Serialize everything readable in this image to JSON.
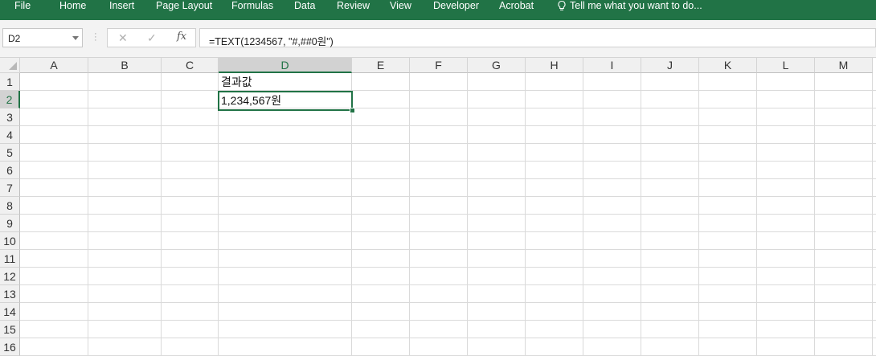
{
  "ribbon": {
    "tabs": [
      "File",
      "Home",
      "Insert",
      "Page Layout",
      "Formulas",
      "Data",
      "Review",
      "View",
      "Developer",
      "Acrobat"
    ],
    "tell_me": "Tell me what you want to do..."
  },
  "formula_bar": {
    "name_box": "D2",
    "cancel_glyph": "✕",
    "enter_glyph": "✓",
    "fx_label": "fx",
    "formula": "=TEXT(1234567, \"#,##0원\")"
  },
  "sheet": {
    "columns": [
      "A",
      "B",
      "C",
      "D",
      "E",
      "F",
      "G",
      "H",
      "I",
      "J",
      "K",
      "L",
      "M"
    ],
    "rows": [
      "1",
      "2",
      "3",
      "4",
      "5",
      "6",
      "7",
      "8",
      "9",
      "10",
      "11",
      "12",
      "13",
      "14",
      "15",
      "16"
    ],
    "selected_column": "D",
    "selected_row": "2",
    "cells": {
      "D1": "결과값",
      "D2": "1,234,567원"
    }
  },
  "colors": {
    "ribbon": "#217346",
    "accent": "#217346"
  }
}
